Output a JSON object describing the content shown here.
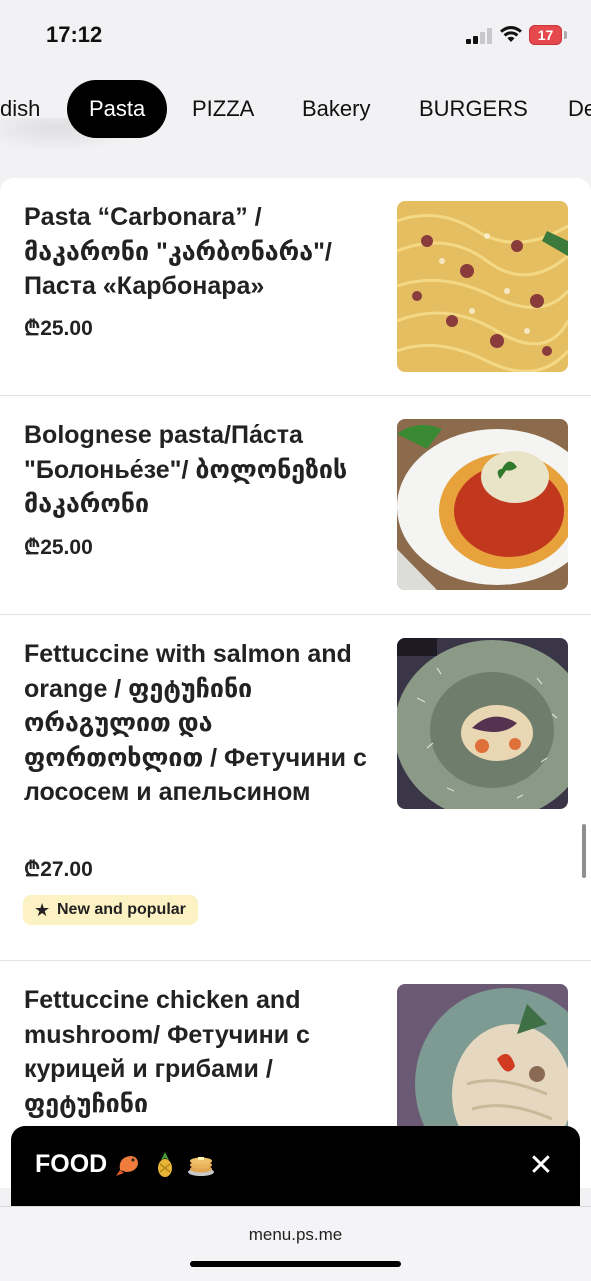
{
  "status_bar": {
    "time": "17:12",
    "battery": "17"
  },
  "categories": [
    {
      "label": "dish",
      "active": false
    },
    {
      "label": "Pasta",
      "active": true
    },
    {
      "label": "PIZZA",
      "active": false
    },
    {
      "label": "Bakery",
      "active": false
    },
    {
      "label": "BURGERS",
      "active": false
    },
    {
      "label": "De",
      "active": false
    }
  ],
  "menu_items": [
    {
      "title": "Pasta “Carbonara” / მაკარონი \"კარბონარა\"/ Паста «Карбонара»",
      "price": "₾25.00"
    },
    {
      "title": "Bolognese pasta/Па́ста \"Болонье́зе\"/ ბოლონეზის მაკარონი",
      "price": "₾25.00"
    },
    {
      "title": "Fettuccine with salmon and orange / ფეტუჩინი ორაგულით და ფორთოხლით / Фетучини с лососем и апельсином",
      "price": "₾27.00",
      "badge": "New and popular"
    },
    {
      "title": "Fettuccine chicken and mushroom/ Фетучини с курицей и грибами / ფეტუჩინი",
      "price": ""
    }
  ],
  "bottom_bar": {
    "label": "FOOD",
    "icons": [
      "shrimp-emoji",
      "pineapple-emoji",
      "pancakes-emoji"
    ]
  },
  "browser": {
    "url": "menu.ps.me"
  }
}
